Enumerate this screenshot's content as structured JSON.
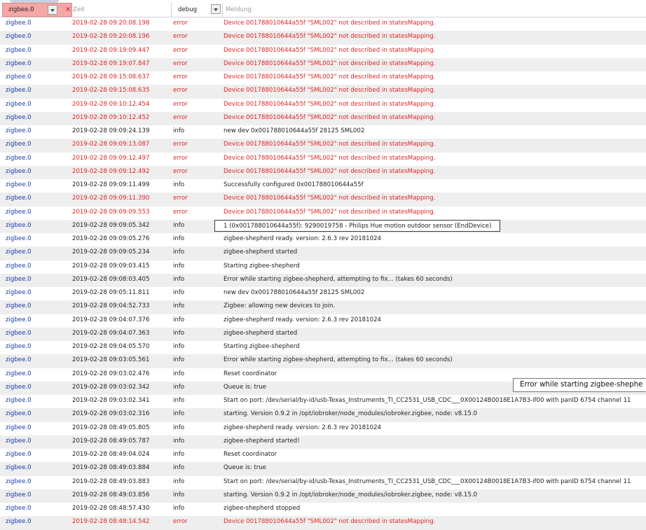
{
  "header": {
    "from_filter": "zigbee.0",
    "clear_label": "×",
    "time_placeholder": "Zeit",
    "severity_filter": "debug",
    "message_placeholder": "Meldung"
  },
  "colors": {
    "error": "#e02424",
    "source": "#1a3aa8",
    "filter_active": "#f5a6a6"
  },
  "rows": [
    {
      "from": "zigbee.0",
      "time": "2019-02-28 09:20:08.198",
      "severity": "error",
      "message": "Device 001788010644a55f \"SML002\" not described in statesMapping."
    },
    {
      "from": "zigbee.0",
      "time": "2019-02-28 09:20:08.196",
      "severity": "error",
      "message": "Device 001788010644a55f \"SML002\" not described in statesMapping."
    },
    {
      "from": "zigbee.0",
      "time": "2019-02-28 09:19:09.447",
      "severity": "error",
      "message": "Device 001788010644a55f \"SML002\" not described in statesMapping."
    },
    {
      "from": "zigbee.0",
      "time": "2019-02-28 09:19:07.847",
      "severity": "error",
      "message": "Device 001788010644a55f \"SML002\" not described in statesMapping."
    },
    {
      "from": "zigbee.0",
      "time": "2019-02-28 09:15:08.637",
      "severity": "error",
      "message": "Device 001788010644a55f \"SML002\" not described in statesMapping."
    },
    {
      "from": "zigbee.0",
      "time": "2019-02-28 09:15:08.635",
      "severity": "error",
      "message": "Device 001788010644a55f \"SML002\" not described in statesMapping."
    },
    {
      "from": "zigbee.0",
      "time": "2019-02-28 09:10:12.454",
      "severity": "error",
      "message": "Device 001788010644a55f \"SML002\" not described in statesMapping."
    },
    {
      "from": "zigbee.0",
      "time": "2019-02-28 09:10:12.452",
      "severity": "error",
      "message": "Device 001788010644a55f \"SML002\" not described in statesMapping."
    },
    {
      "from": "zigbee.0",
      "time": "2019-02-28 09:09:24.139",
      "severity": "info",
      "message": "new dev 0x001788010644a55f 28125 SML002"
    },
    {
      "from": "zigbee.0",
      "time": "2019-02-28 09:09:13.087",
      "severity": "error",
      "message": "Device 001788010644a55f \"SML002\" not described in statesMapping."
    },
    {
      "from": "zigbee.0",
      "time": "2019-02-28 09:09:12.497",
      "severity": "error",
      "message": "Device 001788010644a55f \"SML002\" not described in statesMapping."
    },
    {
      "from": "zigbee.0",
      "time": "2019-02-28 09:09:12.492",
      "severity": "error",
      "message": "Device 001788010644a55f \"SML002\" not described in statesMapping."
    },
    {
      "from": "zigbee.0",
      "time": "2019-02-28 09:09:11.499",
      "severity": "info",
      "message": "Successfully configured 0x001788010644a55f"
    },
    {
      "from": "zigbee.0",
      "time": "2019-02-28 09:09:11.390",
      "severity": "error",
      "message": "Device 001788010644a55f \"SML002\" not described in statesMapping."
    },
    {
      "from": "zigbee.0",
      "time": "2019-02-28 09:09:09.553",
      "severity": "error",
      "message": "Device 001788010644a55f \"SML002\" not described in statesMapping."
    },
    {
      "from": "zigbee.0",
      "time": "2019-02-28 09:09:05.342",
      "severity": "info",
      "message": "1 (0x001788010644a55f): 9290019758 - Philips Hue motion outdoor sensor (EndDevice)",
      "boxed": true
    },
    {
      "from": "zigbee.0",
      "time": "2019-02-28 09:09:05.276",
      "severity": "info",
      "message": "zigbee-shepherd ready. version: 2.6.3 rev 20181024"
    },
    {
      "from": "zigbee.0",
      "time": "2019-02-28 09:09:05.234",
      "severity": "info",
      "message": "zigbee-shepherd started"
    },
    {
      "from": "zigbee.0",
      "time": "2019-02-28 09:09:03.415",
      "severity": "info",
      "message": "Starting zigbee-shepherd"
    },
    {
      "from": "zigbee.0",
      "time": "2019-02-28 09:08:03.405",
      "severity": "info",
      "message": "Error while starting zigbee-shepherd, attempting to fix... (takes 60 seconds)"
    },
    {
      "from": "zigbee.0",
      "time": "2019-02-28 09:05:11.811",
      "severity": "info",
      "message": "new dev 0x001788010644a55f 28125 SML002"
    },
    {
      "from": "zigbee.0",
      "time": "2019-02-28 09:04:52.733",
      "severity": "info",
      "message": "Zigbee: allowing new devices to join."
    },
    {
      "from": "zigbee.0",
      "time": "2019-02-28 09:04:07.376",
      "severity": "info",
      "message": "zigbee-shepherd ready. version: 2.6.3 rev 20181024"
    },
    {
      "from": "zigbee.0",
      "time": "2019-02-28 09:04:07.363",
      "severity": "info",
      "message": "zigbee-shepherd started"
    },
    {
      "from": "zigbee.0",
      "time": "2019-02-28 09:04:05.570",
      "severity": "info",
      "message": "Starting zigbee-shepherd"
    },
    {
      "from": "zigbee.0",
      "time": "2019-02-28 09:03:05.561",
      "severity": "info",
      "message": "Error while starting zigbee-shepherd, attempting to fix... (takes 60 seconds)"
    },
    {
      "from": "zigbee.0",
      "time": "2019-02-28 09:03:02.476",
      "severity": "info",
      "message": "Reset coordinator"
    },
    {
      "from": "zigbee.0",
      "time": "2019-02-28 09:03:02.342",
      "severity": "info",
      "message": "Queue is: true"
    },
    {
      "from": "zigbee.0",
      "time": "2019-02-28 09:03:02.341",
      "severity": "info",
      "message": "Start on port: /dev/serial/by-id/usb-Texas_Instruments_TI_CC2531_USB_CDC___0X00124B0018E1A7B3-if00 with panID 6754 channel 11"
    },
    {
      "from": "zigbee.0",
      "time": "2019-02-28 09:03:02.316",
      "severity": "info",
      "message": "starting. Version 0.9.2 in /opt/iobroker/node_modules/iobroker.zigbee, node: v8.15.0"
    },
    {
      "from": "zigbee.0",
      "time": "2019-02-28 08:49:05.805",
      "severity": "info",
      "message": "zigbee-shepherd ready. version: 2.6.3 rev 20181024"
    },
    {
      "from": "zigbee.0",
      "time": "2019-02-28 08:49:05.787",
      "severity": "info",
      "message": "zigbee-shepherd started!"
    },
    {
      "from": "zigbee.0",
      "time": "2019-02-28 08:49:04.024",
      "severity": "info",
      "message": "Reset coordinator"
    },
    {
      "from": "zigbee.0",
      "time": "2019-02-28 08:49:03.884",
      "severity": "info",
      "message": "Queue is: true"
    },
    {
      "from": "zigbee.0",
      "time": "2019-02-28 08:49:03.883",
      "severity": "info",
      "message": "Start on port: /dev/serial/by-id/usb-Texas_Instruments_TI_CC2531_USB_CDC___0X00124B0018E1A7B3-if00 with panID 6754 channel 11"
    },
    {
      "from": "zigbee.0",
      "time": "2019-02-28 08:49:03.856",
      "severity": "info",
      "message": "starting. Version 0.9.2 in /opt/iobroker/node_modules/iobroker.zigbee, node: v8.15.0"
    },
    {
      "from": "zigbee.0",
      "time": "2019-02-28 08:48:57.430",
      "severity": "info",
      "message": "zigbee-shepherd stopped"
    },
    {
      "from": "zigbee.0",
      "time": "2019-02-28 08:48:14.542",
      "severity": "error",
      "message": "Device 001788010644a55f \"SML002\" not described in statesMapping."
    }
  ],
  "tooltip": {
    "text": "Error while starting zigbee-shephe"
  }
}
